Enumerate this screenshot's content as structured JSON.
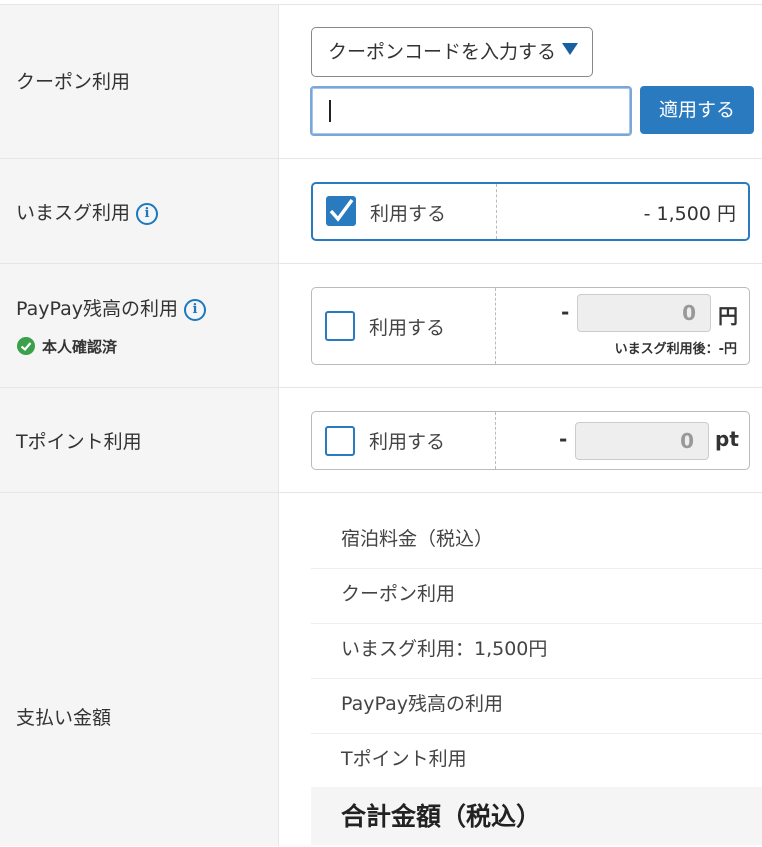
{
  "coupon": {
    "label": "クーポン利用",
    "select_value": "クーポンコードを入力する",
    "input_value": "",
    "apply_label": "適用する"
  },
  "imasugu": {
    "label": "いまスグ利用",
    "use_label": "利用する",
    "checked": true,
    "amount": "- 1,500 円"
  },
  "paypay": {
    "label": "PayPay残高の利用",
    "verified": "本人確認済",
    "use_label": "利用する",
    "checked": false,
    "minus": "-",
    "value": "0",
    "unit": "円",
    "note": "いまスグ利用後：-円"
  },
  "tpoint": {
    "label": "Tポイント利用",
    "use_label": "利用する",
    "checked": false,
    "minus": "-",
    "value": "0",
    "unit": "pt"
  },
  "payment": {
    "label": "支払い金額",
    "lines": [
      "宿泊料金（税込）",
      "クーポン利用",
      "いまスグ利用：1,500円",
      "PayPay残高の利用",
      "Tポイント利用"
    ],
    "total_label": "合計金額（税込）"
  },
  "colors": {
    "accent": "#2a7abf",
    "verified": "#3aa04a",
    "label_bg": "#f5f5f5"
  }
}
